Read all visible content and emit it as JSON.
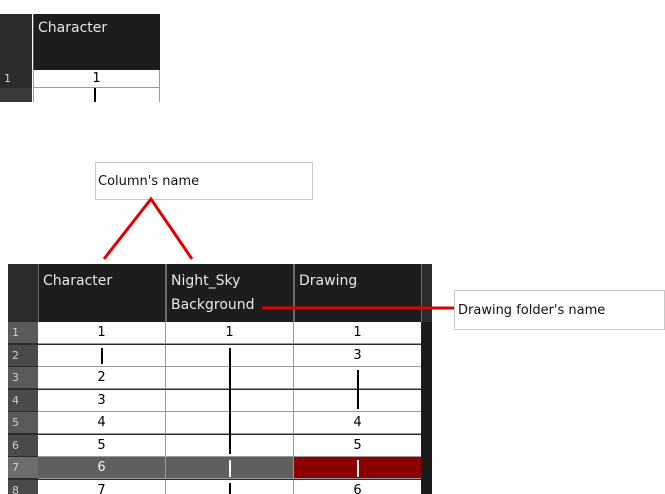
{
  "snippet": {
    "column_header": "Character",
    "rows": [
      {
        "num": "1",
        "value": "1"
      }
    ]
  },
  "callouts": {
    "column_name": "Column's name",
    "drawing_folder_name": "Drawing folder's name"
  },
  "xsheet": {
    "columns": [
      {
        "name": "Character",
        "folder": ""
      },
      {
        "name": "Night_Sky",
        "folder": "Background"
      },
      {
        "name": "Drawing",
        "folder": ""
      }
    ],
    "rows": [
      {
        "num": "1",
        "cells": [
          "1",
          "1",
          "1"
        ]
      },
      {
        "num": "2",
        "cells": [
          "",
          "",
          "3"
        ]
      },
      {
        "num": "3",
        "cells": [
          "2",
          "",
          ""
        ]
      },
      {
        "num": "4",
        "cells": [
          "3",
          "",
          ""
        ]
      },
      {
        "num": "5",
        "cells": [
          "4",
          "",
          "4"
        ]
      },
      {
        "num": "6",
        "cells": [
          "5",
          "",
          "5"
        ]
      },
      {
        "num": "7",
        "cells": [
          "6",
          "",
          ""
        ]
      },
      {
        "num": "8",
        "cells": [
          "7",
          "",
          "6"
        ]
      }
    ],
    "selected_row": "7",
    "colors": {
      "header_bg": "#1d1d1d",
      "selected_row": "#5f5f5f",
      "selected_cell": "#8b0000",
      "annotation": "#e00000"
    }
  }
}
